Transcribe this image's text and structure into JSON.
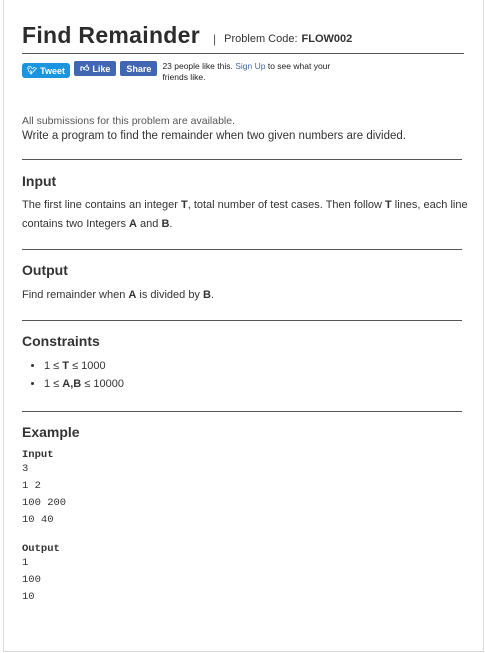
{
  "header": {
    "title": "Find Remainder",
    "separator": "|",
    "problem_code_label": "Problem Code:",
    "problem_code": "FLOW002"
  },
  "social": {
    "tweet_label": "Tweet",
    "like_label": "Like",
    "share_label": "Share",
    "likes_text": "23 people like this.",
    "signup_label": "Sign Up",
    "signup_suffix": "to see what your friends like.",
    "twitter_color": "#1b95e0",
    "facebook_color": "#4267b2"
  },
  "intro": {
    "availability": "All submissions for this problem are available.",
    "statement": "Write a program to find the remainder when two given numbers are divided."
  },
  "input_section": {
    "heading": "Input",
    "p1": "The first line contains an integer ",
    "t1": "T",
    "p2": ", total number of test cases. Then follow ",
    "t2": "T",
    "p3": " lines, each line contains two Integers ",
    "a": "A",
    "p4": " and ",
    "b": "B",
    "p5": "."
  },
  "output_section": {
    "heading": "Output",
    "p1": "Find remainder when ",
    "a": "A",
    "p2": " is divided by ",
    "b": "B",
    "p3": "."
  },
  "constraints": {
    "heading": "Constraints",
    "items": [
      {
        "pre": "1 ≤ ",
        "bold": "T",
        "post": " ≤ 1000"
      },
      {
        "pre": "1 ≤ ",
        "bold": "A,B",
        "post": " ≤ 10000"
      }
    ]
  },
  "example": {
    "heading": "Example",
    "input_label": "Input",
    "input_text": "3\n1 2\n100 200\n10 40",
    "output_label": "Output",
    "output_text": "1\n100\n10"
  }
}
